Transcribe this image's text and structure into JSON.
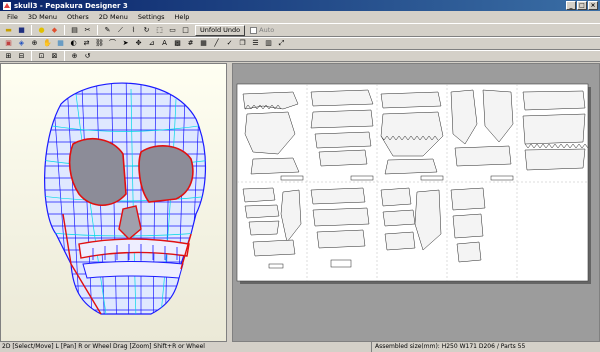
{
  "window": {
    "title": "skull3 - Pepakura Designer 3",
    "controls": [
      "_",
      "□",
      "×"
    ]
  },
  "menu": [
    "File",
    "3D Menu",
    "Others",
    "2D Menu",
    "Settings",
    "Help"
  ],
  "toolbar": {
    "unfold_undo_label": "Unfold Undo",
    "auto_label": "Auto"
  },
  "status": {
    "hint": "2D [Select/Move] L [Pan] R or Wheel Drag [Zoom] Shift+R or Wheel",
    "info": "Assembled size(mm): H250 W171 D206 / Parts 55"
  },
  "colors": {
    "accent_title": "#0a246a",
    "wire_blue": "#1a1aff",
    "wire_cyan": "#00d8e8",
    "wire_red": "#e01010"
  }
}
